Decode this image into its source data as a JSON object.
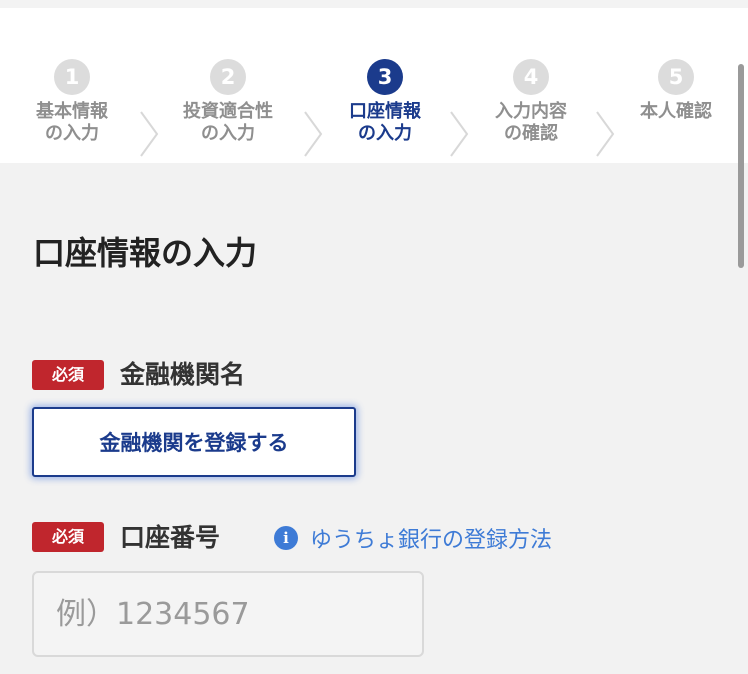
{
  "stepper": {
    "steps": [
      {
        "number": "1",
        "label": "基本情報\nの入力",
        "active": false
      },
      {
        "number": "2",
        "label": "投資適合性\nの入力",
        "active": false
      },
      {
        "number": "3",
        "label": "口座情報\nの入力",
        "active": true
      },
      {
        "number": "4",
        "label": "入力内容\nの確認",
        "active": false
      },
      {
        "number": "5",
        "label": "本人確認",
        "active": false
      }
    ]
  },
  "page": {
    "title": "口座情報の入力"
  },
  "bank": {
    "required_badge": "必須",
    "label": "金融機関名",
    "button_label": "金融機関を登録する"
  },
  "account": {
    "required_badge": "必須",
    "label": "口座番号",
    "help_link": "ゆうちょ銀行の登録方法",
    "info_icon_glyph": "i",
    "placeholder": "例）1234567"
  },
  "colors": {
    "accent": "#1b3b8c",
    "required": "#c0262d",
    "link": "#3e7bd6",
    "inactive_step": "#dcdcdc"
  }
}
